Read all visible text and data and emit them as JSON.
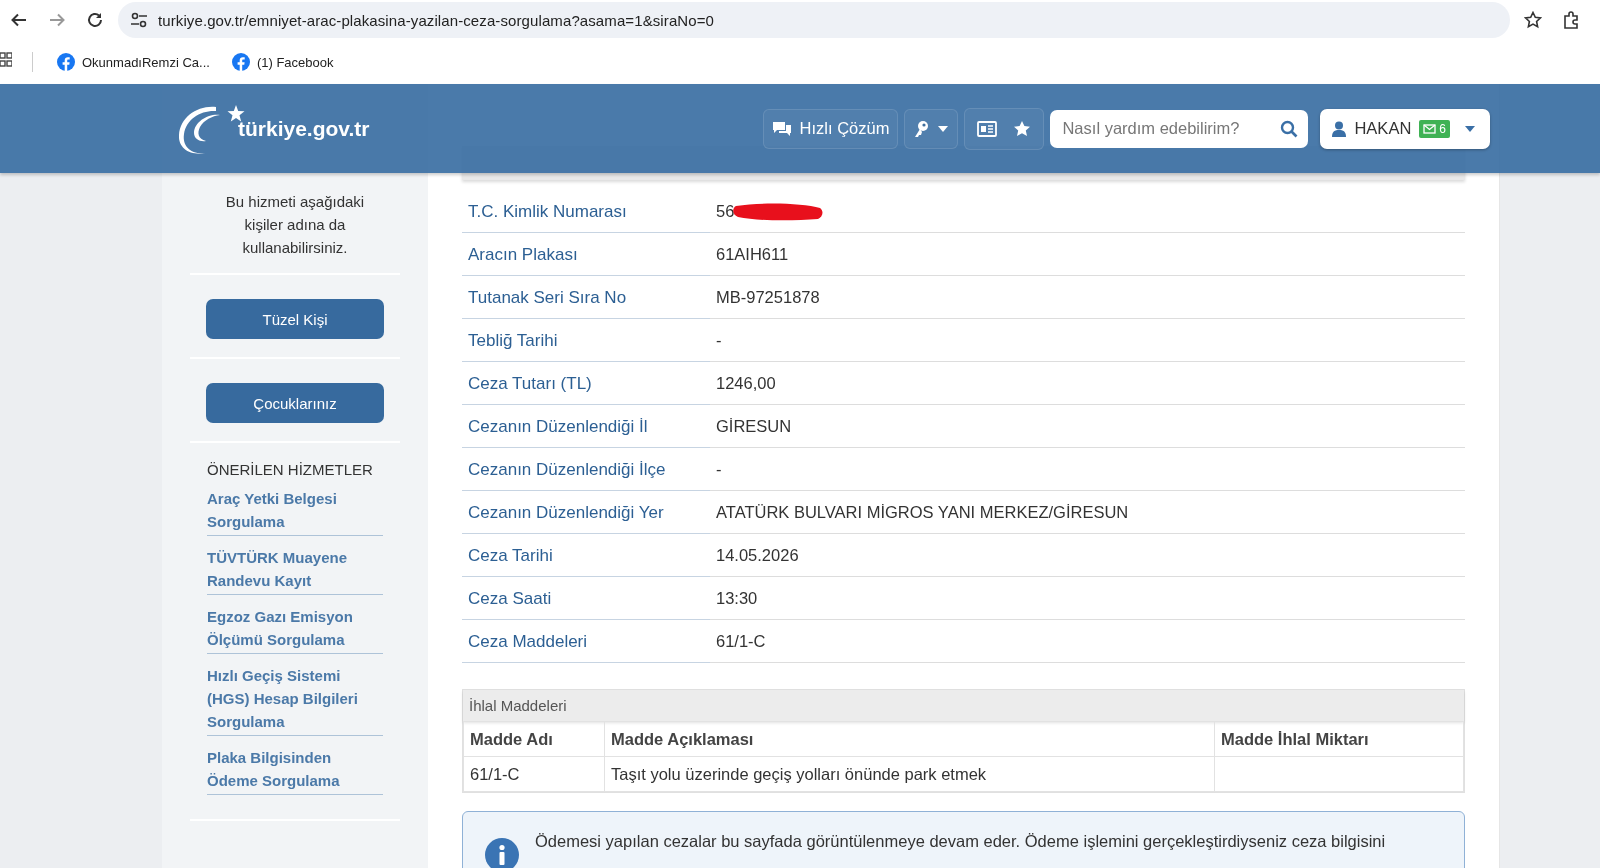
{
  "browser": {
    "url": "turkiye.gov.tr/emniyet-arac-plakasina-yazilan-ceza-sorgulama?asama=1&siraNo=0",
    "bookmarks": [
      {
        "label": "OkunmadıRemzi Ca..."
      },
      {
        "label": "(1) Facebook"
      }
    ]
  },
  "header": {
    "logo_text": "türkiye.gov.tr",
    "quick_solution": "Hızlı Çözüm",
    "search": {
      "placeholder": "Nasıl yardım edebilirim?"
    },
    "user": {
      "name": "HAKAN",
      "message_count": "6"
    }
  },
  "sidebar": {
    "intro": "Bu hizmeti aşağıdaki kişiler adına da kullanabilirsiniz.",
    "buttons": [
      "Tüzel Kişi",
      "Çocuklarınız"
    ],
    "recommended_title": "ÖNERİLEN HİZMETLER",
    "recommended": [
      "Araç Yetki Belgesi Sorgulama",
      "TÜVTÜRK Muayene Randevu Kayıt",
      "Egzoz Gazı Emisyon Ölçümü Sorgulama",
      "Hızlı Geçiş Sistemi (HGS) Hesap Bilgileri Sorgulama",
      "Plaka Bilgisinden Ödeme Sorgulama"
    ]
  },
  "main": {
    "fields": [
      {
        "label": "T.C. Kimlik Numarası",
        "value": "56",
        "redacted": true
      },
      {
        "label": "Aracın Plakası",
        "value": "61AIH611",
        "redacted": false
      },
      {
        "label": "Tutanak Seri Sıra No",
        "value": "MB-97251878",
        "redacted": false
      },
      {
        "label": "Tebliğ Tarihi",
        "value": "-",
        "redacted": false
      },
      {
        "label": "Ceza Tutarı (TL)",
        "value": "1246,00",
        "redacted": false
      },
      {
        "label": "Cezanın Düzenlendiği İl",
        "value": "GİRESUN",
        "redacted": false
      },
      {
        "label": "Cezanın Düzenlendiği İlçe",
        "value": "-",
        "redacted": false
      },
      {
        "label": "Cezanın Düzenlendiği Yer",
        "value": "ATATÜRK BULVARI MİGROS YANI MERKEZ/GİRESUN",
        "redacted": false
      },
      {
        "label": "Ceza Tarihi",
        "value": "14.05.2026",
        "redacted": false
      },
      {
        "label": "Ceza Saati",
        "value": "13:30",
        "redacted": false
      },
      {
        "label": "Ceza Maddeleri",
        "value": "61/1-C",
        "redacted": false
      }
    ],
    "violations": {
      "title": "İhlal Maddeleri",
      "columns": [
        "Madde Adı",
        "Madde Açıklaması",
        "Madde İhlal Miktarı"
      ],
      "rows": [
        [
          "61/1-C",
          "Taşıt yolu üzerinde geçiş yolları önünde park etmek",
          ""
        ]
      ]
    },
    "info": "Ödemesi yapılan cezalar bu sayfada görüntülenmeye devam eder. Ödeme işlemini gerçekleştirdiyseniz ceza bilgisini"
  }
}
